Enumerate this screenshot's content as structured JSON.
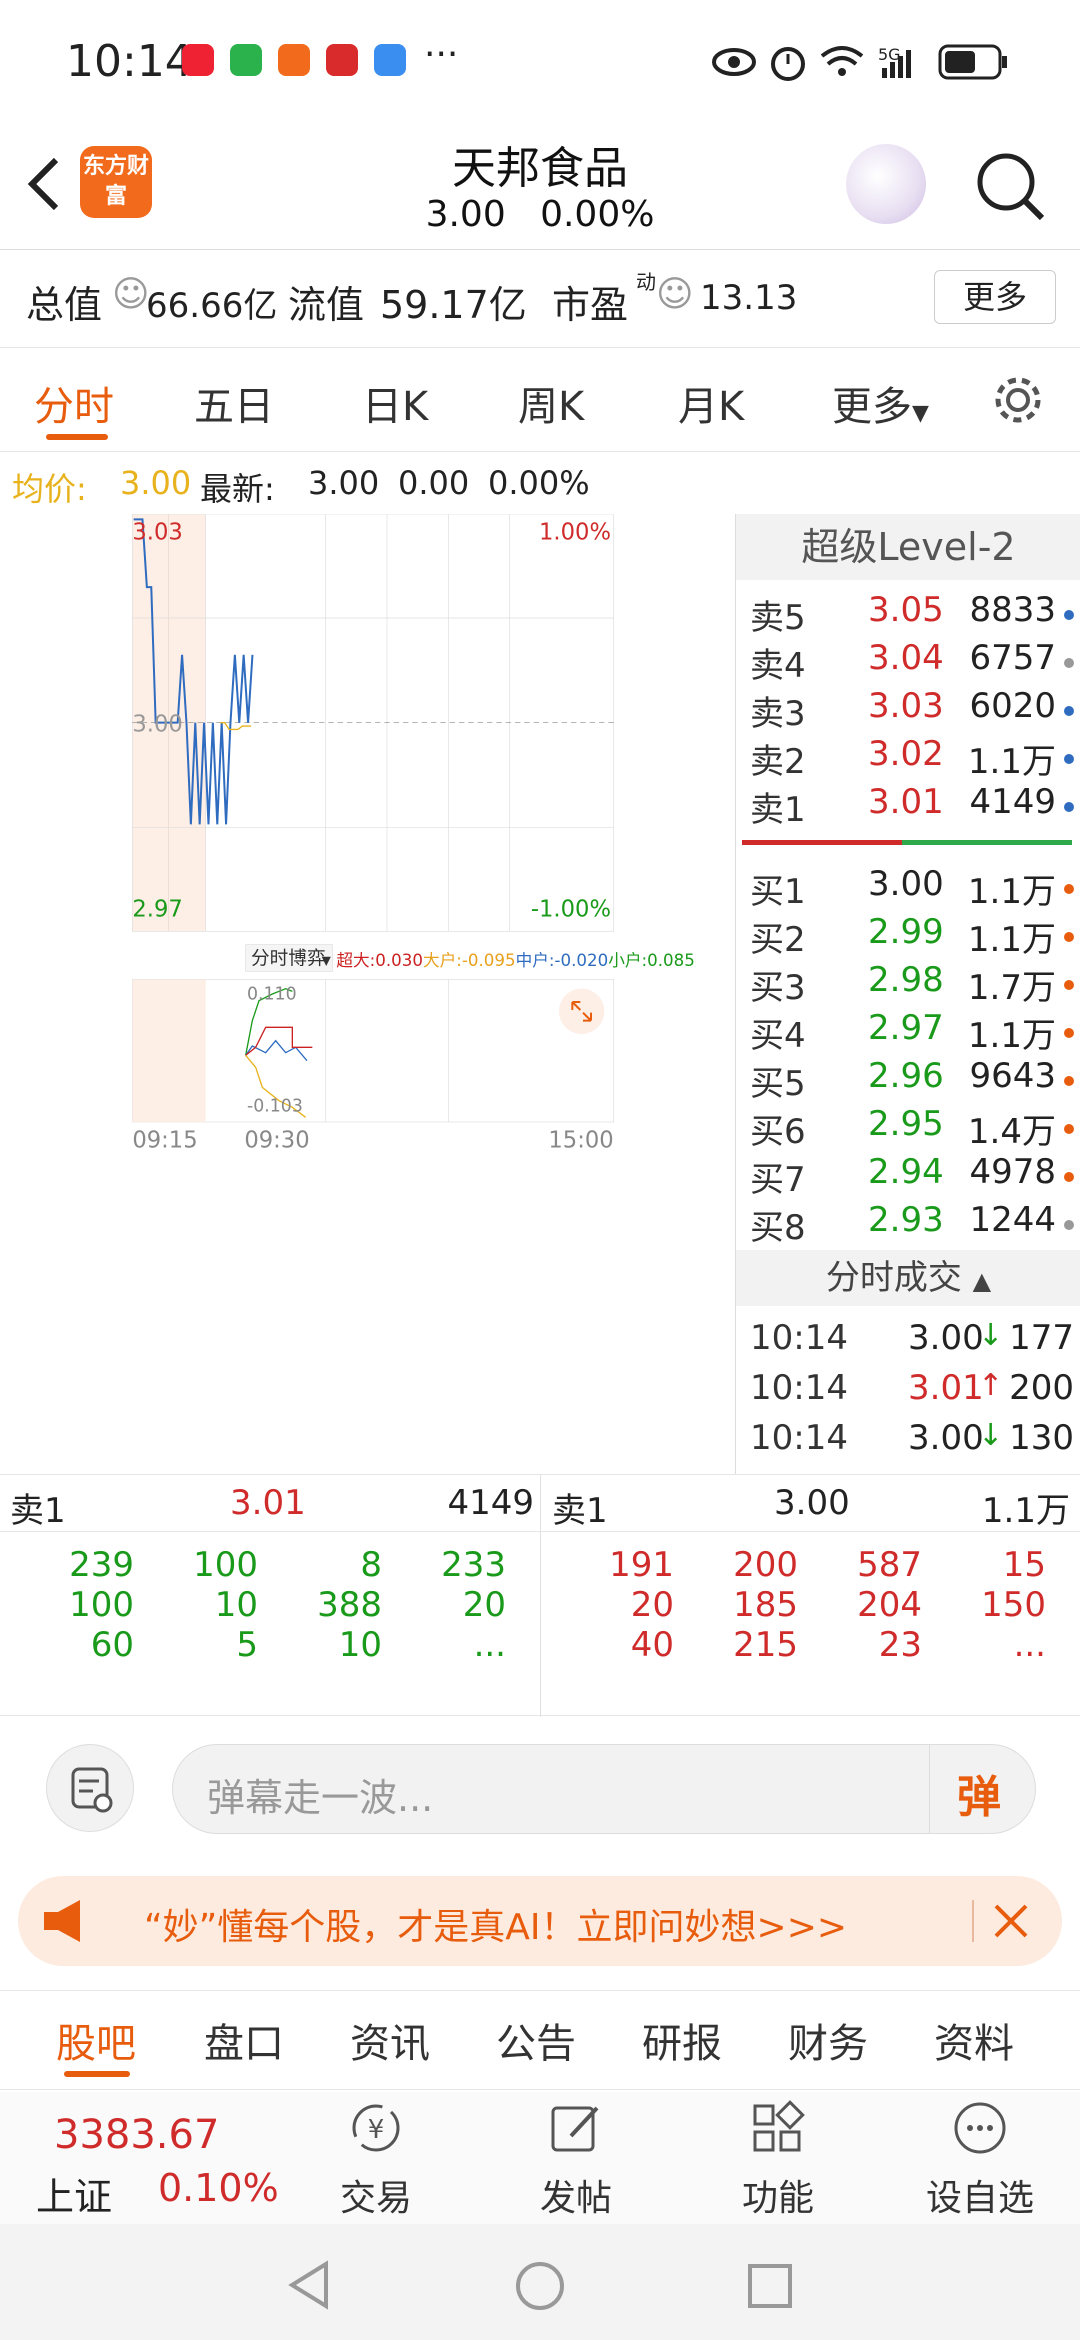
{
  "status": {
    "time": "10:14",
    "network": "5G"
  },
  "header": {
    "logo_text": "东方财富",
    "title": "天邦食品",
    "price": "3.00",
    "change_pct": "0.00%"
  },
  "stats": {
    "total_label": "总值",
    "total_value": "66.66亿",
    "float_label": "流值",
    "float_value": "59.17亿",
    "pe_label": "市盈",
    "pe_sup": "动",
    "pe_value": "13.13",
    "more": "更多"
  },
  "tabs": [
    "分时",
    "五日",
    "日K",
    "周K",
    "月K",
    "更多"
  ],
  "avg": {
    "label": "均价:",
    "value": "3.00",
    "latest_label": "最新:",
    "latest": "3.00",
    "change": "0.00",
    "pct": "0.00%"
  },
  "chart_data": {
    "type": "line",
    "title": "",
    "y_top": "3.03",
    "y_mid": "3.00",
    "y_bottom": "2.97",
    "pct_top": "1.00%",
    "pct_bottom": "-1.00%",
    "x_ticks": [
      "09:15",
      "09:30",
      "15:00"
    ],
    "ylim": [
      2.97,
      3.03
    ],
    "series": [
      {
        "color": "#2f6cc0",
        "values": [
          3.03,
          3.03,
          3.03,
          3.02,
          3.02,
          3.0,
          3.0,
          3.0,
          3.0,
          3.0,
          3.0,
          3.01,
          3.0,
          2.985,
          3.0,
          2.985,
          3.0,
          2.985,
          3.0,
          2.985,
          3.0,
          2.985,
          3.0,
          3.01,
          3.0,
          3.01,
          3.0,
          3.01
        ]
      },
      {
        "color": "#e8b21d",
        "values": [
          3.0,
          3.0,
          2.999,
          2.999,
          2.999,
          2.9995,
          2.9995,
          2.9995
        ]
      }
    ],
    "sub_label": "分时博弈",
    "sub_top": "0.110",
    "sub_bottom": "-0.103",
    "flows": [
      {
        "name": "超大",
        "value": "0.030",
        "color": "#c22"
      },
      {
        "name": "大户",
        "value": "-0.095",
        "color": "#e8a01d"
      },
      {
        "name": "中户",
        "value": "-0.020",
        "color": "#2f6cc0"
      },
      {
        "name": "小户",
        "value": "0.085",
        "color": "#1a9a1a"
      }
    ]
  },
  "level2": {
    "title": "超级Level-2",
    "sells": [
      {
        "label": "卖5",
        "price": "3.05",
        "vol": "8833",
        "dot": "#2f6cc0"
      },
      {
        "label": "卖4",
        "price": "3.04",
        "vol": "6757",
        "dot": "#999"
      },
      {
        "label": "卖3",
        "price": "3.03",
        "vol": "6020",
        "dot": "#2f6cc0"
      },
      {
        "label": "卖2",
        "price": "3.02",
        "vol": "1.1万",
        "dot": "#2f6cc0"
      },
      {
        "label": "卖1",
        "price": "3.01",
        "vol": "4149",
        "dot": "#2f6cc0"
      }
    ],
    "buys": [
      {
        "label": "买1",
        "price": "3.00",
        "vol": "1.1万",
        "dot": "#e85c0d"
      },
      {
        "label": "买2",
        "price": "2.99",
        "vol": "1.1万",
        "dot": "#e85c0d"
      },
      {
        "label": "买3",
        "price": "2.98",
        "vol": "1.7万",
        "dot": "#e85c0d"
      },
      {
        "label": "买4",
        "price": "2.97",
        "vol": "1.1万",
        "dot": "#e85c0d"
      },
      {
        "label": "买5",
        "price": "2.96",
        "vol": "9643",
        "dot": "#e85c0d"
      },
      {
        "label": "买6",
        "price": "2.95",
        "vol": "1.4万",
        "dot": "#e85c0d"
      },
      {
        "label": "买7",
        "price": "2.94",
        "vol": "4978",
        "dot": "#e85c0d"
      },
      {
        "label": "买8",
        "price": "2.93",
        "vol": "1244",
        "dot": "#999"
      }
    ],
    "ticks_title": "分时成交",
    "ticks": [
      {
        "time": "10:14",
        "price": "3.00",
        "arrow": "↓",
        "vol": "177"
      },
      {
        "time": "10:14",
        "price": "3.01",
        "arrow": "↑",
        "vol": "200"
      },
      {
        "time": "10:14",
        "price": "3.00",
        "arrow": "↓",
        "vol": "130"
      }
    ]
  },
  "queues": {
    "sell_label": "卖1",
    "sell_price": "3.01",
    "sell_vol": "4149",
    "buy_label": "卖1",
    "buy_price": "3.00",
    "buy_vol": "1.1万",
    "sell_rows": [
      [
        "239",
        "100",
        "8",
        "233"
      ],
      [
        "100",
        "10",
        "388",
        "20"
      ],
      [
        "60",
        "5",
        "10",
        "..."
      ]
    ],
    "buy_rows": [
      [
        "191",
        "200",
        "587",
        "15"
      ],
      [
        "20",
        "185",
        "204",
        "150"
      ],
      [
        "40",
        "215",
        "23",
        "..."
      ]
    ]
  },
  "danmu": {
    "placeholder": "弹幕走一波...",
    "send": "弹"
  },
  "banner": {
    "text": "“妙”懂每个股，才是真AI！立即问妙想>>>"
  },
  "info_tabs": [
    "股吧",
    "盘口",
    "资讯",
    "公告",
    "研报",
    "财务",
    "资料"
  ],
  "nav": {
    "index_value": "3383.67",
    "index_name": "上证",
    "index_pct": "0.10%",
    "items": [
      "交易",
      "发帖",
      "功能",
      "设自选"
    ]
  }
}
